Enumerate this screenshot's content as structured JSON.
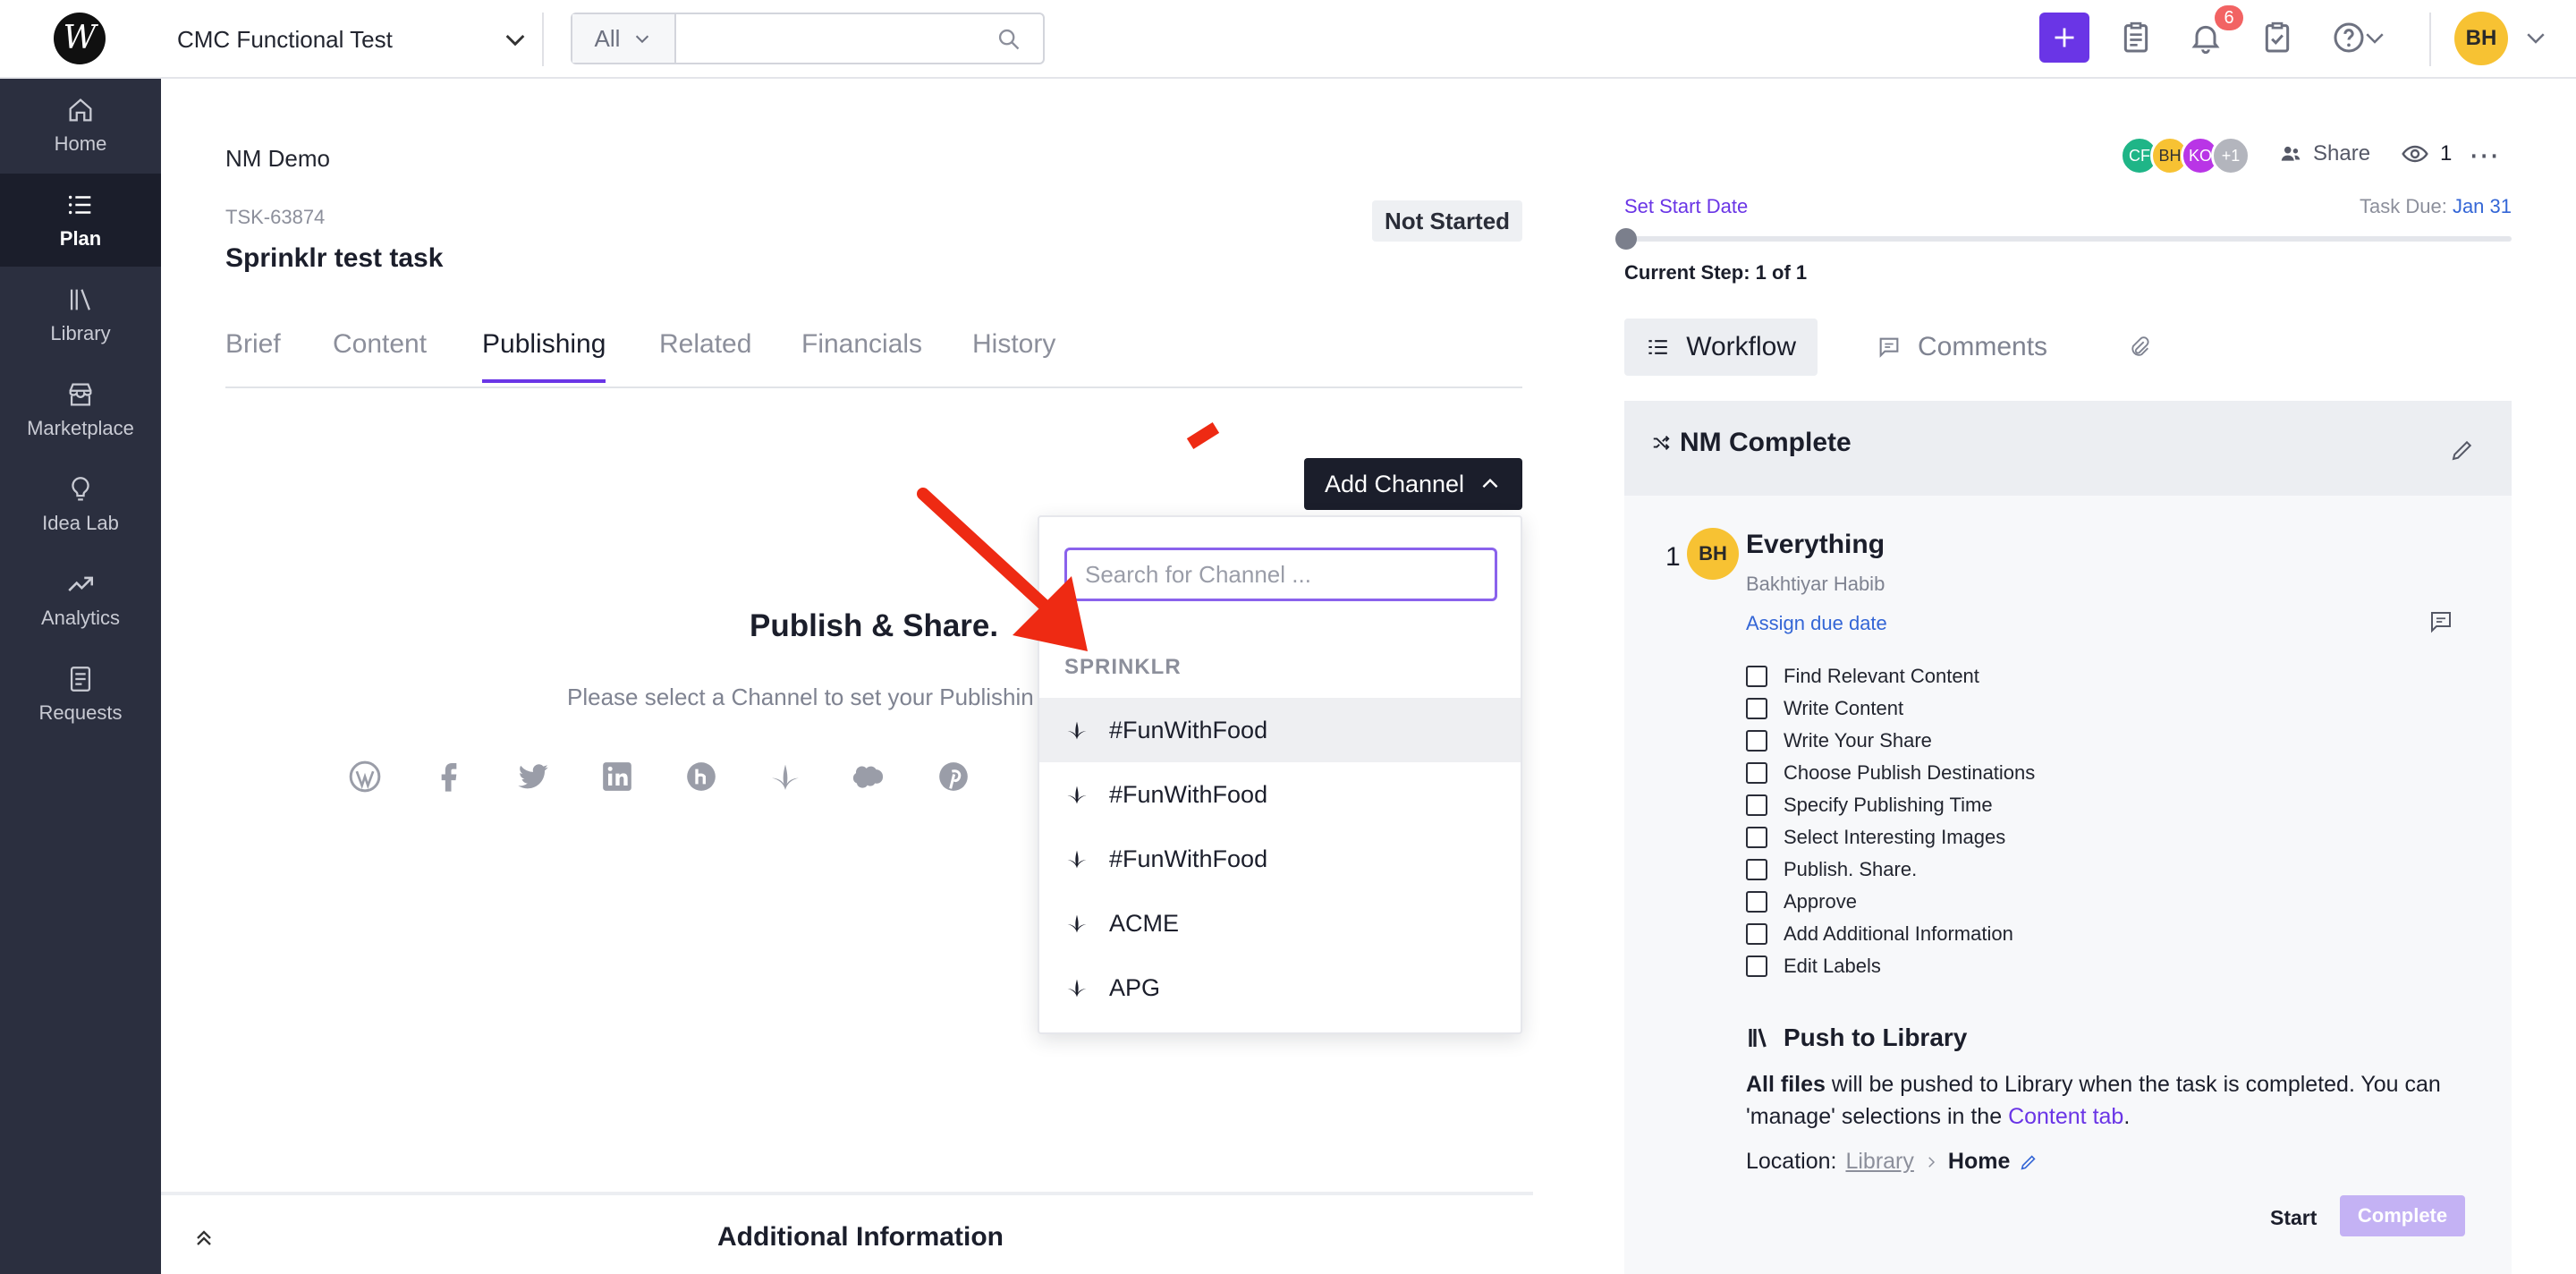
{
  "topbar": {
    "logo_text": "W",
    "project_name": "CMC Functional Test",
    "search_scope": "All",
    "search_placeholder": "",
    "notification_count": "6",
    "user_initials": "BH"
  },
  "sidebar": {
    "items": [
      {
        "label": "Home",
        "icon": "home-icon"
      },
      {
        "label": "Plan",
        "icon": "list-icon",
        "active": true
      },
      {
        "label": "Library",
        "icon": "library-icon"
      },
      {
        "label": "Marketplace",
        "icon": "store-icon"
      },
      {
        "label": "Idea Lab",
        "icon": "lightbulb-icon"
      },
      {
        "label": "Analytics",
        "icon": "trend-icon"
      },
      {
        "label": "Requests",
        "icon": "request-icon"
      }
    ]
  },
  "task": {
    "project": "NM Demo",
    "id": "TSK-63874",
    "title": "Sprinklr test task",
    "status": "Not Started",
    "tabs": [
      "Brief",
      "Content",
      "Publishing",
      "Related",
      "Financials",
      "History"
    ],
    "active_tab": "Publishing"
  },
  "publishing": {
    "add_channel_label": "Add Channel",
    "title": "Publish & Share.",
    "subtitle": "Please select a Channel to set your Publishin",
    "channel_icons": [
      "wordpress-icon",
      "facebook-icon",
      "twitter-icon",
      "linkedin-icon",
      "hootsuite-icon",
      "sprinklr-icon",
      "salesforce-icon",
      "pinterest-icon"
    ]
  },
  "dropdown": {
    "search_placeholder": "Search for Channel ...",
    "group_label": "SPRINKLR",
    "items": [
      "#FunWithFood",
      "#FunWithFood",
      "#FunWithFood",
      "ACME",
      "APG"
    ]
  },
  "additional": {
    "title": "Additional Information"
  },
  "right": {
    "collaborators": [
      {
        "initials": "CF",
        "color": "#1fb587"
      },
      {
        "initials": "BH",
        "color": "#f7c233"
      },
      {
        "initials": "KO",
        "color": "#b935e6"
      },
      {
        "initials": "+1",
        "color": "#b3b5bd"
      }
    ],
    "share_label": "Share",
    "viewers": "1",
    "set_start_label": "Set Start Date",
    "task_due_label": "Task Due:",
    "task_due_date": "Jan 31",
    "current_step": "Current Step: 1 of 1",
    "tabs": {
      "workflow": "Workflow",
      "comments": "Comments"
    },
    "workflow_name": "NM Complete",
    "step": {
      "number": "1",
      "initials": "BH",
      "title": "Everything",
      "assignee": "Bakhtiyar Habib",
      "assign_due": "Assign due date",
      "checklist": [
        "Find Relevant Content",
        "Write Content",
        "Write Your Share",
        "Choose Publish Destinations",
        "Specify Publishing Time",
        "Select Interesting Images",
        "Publish. Share.",
        "Approve",
        "Add Additional Information",
        "Edit Labels"
      ]
    },
    "push": {
      "title": "Push to Library",
      "bold": "All files",
      "text1": " will be pushed to Library when the task is completed. You can 'manage' selections in the ",
      "link": "Content tab",
      "text2": ".",
      "location_label": "Location:",
      "location_link": "Library",
      "location_current": "Home"
    },
    "start_label": "Start",
    "complete_label": "Complete"
  }
}
